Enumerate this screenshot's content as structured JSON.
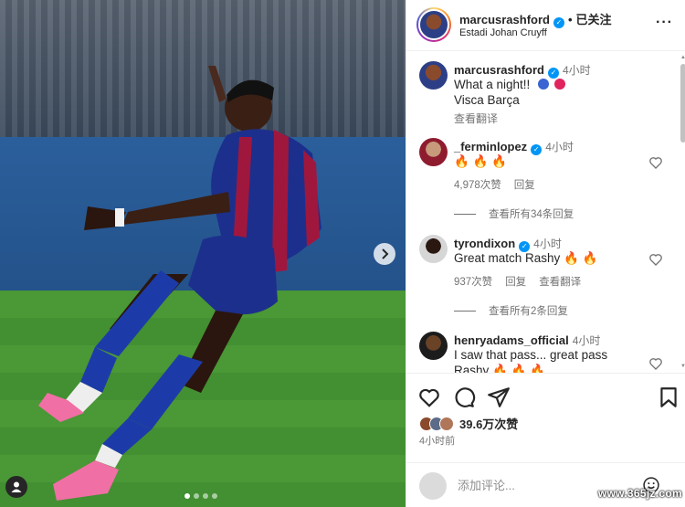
{
  "post": {
    "next_icon": "chevron-right-icon",
    "tag_icon": "user-tag-icon"
  },
  "header": {
    "username": "marcusrashford",
    "dot": "•",
    "follow_state": "已关注",
    "location": "Estadi Johan Cruyff",
    "more_icon": "more-icon",
    "more": "···"
  },
  "caption": {
    "username": "marcusrashford",
    "time": "4小时",
    "line1": "What a night!!",
    "line2": "Visca Barça",
    "translate": "查看翻译"
  },
  "comments": [
    {
      "username": "_ferminlopez",
      "time": "4小时",
      "text": "🔥 🔥 🔥",
      "likes": "4,978次赞",
      "reply": "回复",
      "view_replies": "查看所有34条回复"
    },
    {
      "username": "tyrondixon",
      "time": "4小时",
      "text": "Great match Rashy",
      "text_emoji": "🔥 🔥",
      "likes": "937次赞",
      "reply": "回复",
      "translate": "查看翻译",
      "view_replies": "查看所有2条回复"
    },
    {
      "username": "henryadams_official",
      "time": "4小时",
      "text": "I saw that pass... great pass",
      "text2": "Rashy 🔥 🔥 🔥"
    }
  ],
  "actions": {
    "like_icon": "heart-icon",
    "comment_icon": "comment-icon",
    "share_icon": "share-icon",
    "save_icon": "bookmark-icon"
  },
  "likes": "39.6万次赞",
  "posted_ago": "4小时前",
  "composer": {
    "placeholder": "添加评论...",
    "emoji_icon": "emoji-icon"
  },
  "watermark": "www.365jz.com",
  "colors": {
    "verified": "#0095f6",
    "fire": "#f35b14",
    "muted_text": "#737373"
  }
}
